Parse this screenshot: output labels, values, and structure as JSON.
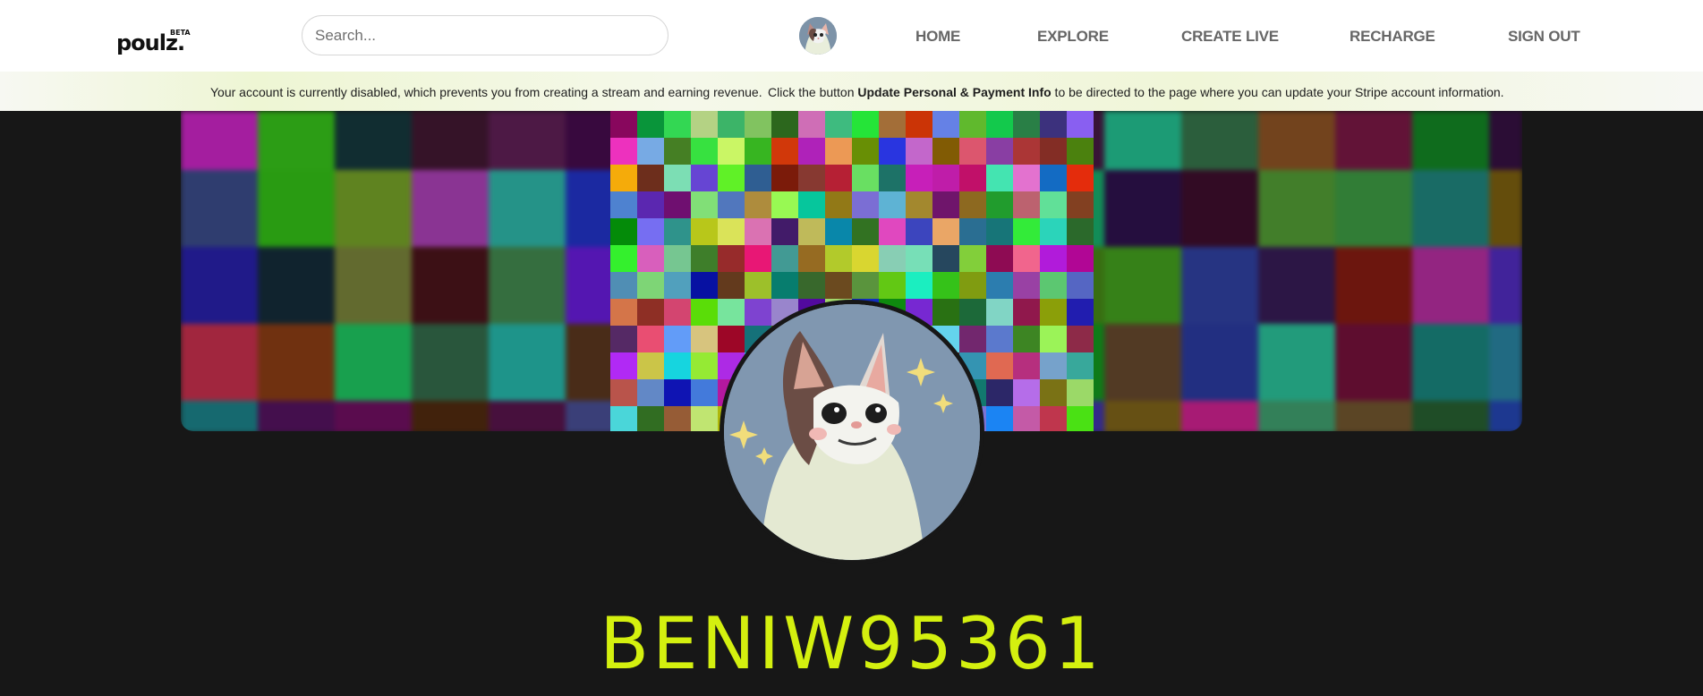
{
  "brand": {
    "name": "poulz.",
    "badge": "BETA"
  },
  "search": {
    "placeholder": "Search..."
  },
  "nav": {
    "home": "HOME",
    "explore": "EXPLORE",
    "create_live": "CREATE LIVE",
    "recharge": "RECHARGE",
    "sign_out": "SIGN OUT"
  },
  "notice": {
    "part1": "Your account is currently disabled, which prevents you from creating a stream and earning revenue.",
    "part2_prefix": "Click the button ",
    "part2_bold": "Update Personal & Payment Info",
    "part2_suffix": " to be directed to the page where you can update your Stripe account information."
  },
  "profile": {
    "username": "BENIW95361"
  },
  "colors": {
    "username": "#d4f00f",
    "background": "#171717"
  },
  "icons": {
    "avatar": "cat-avatar-icon",
    "cover": "mosaic-cover-image"
  }
}
